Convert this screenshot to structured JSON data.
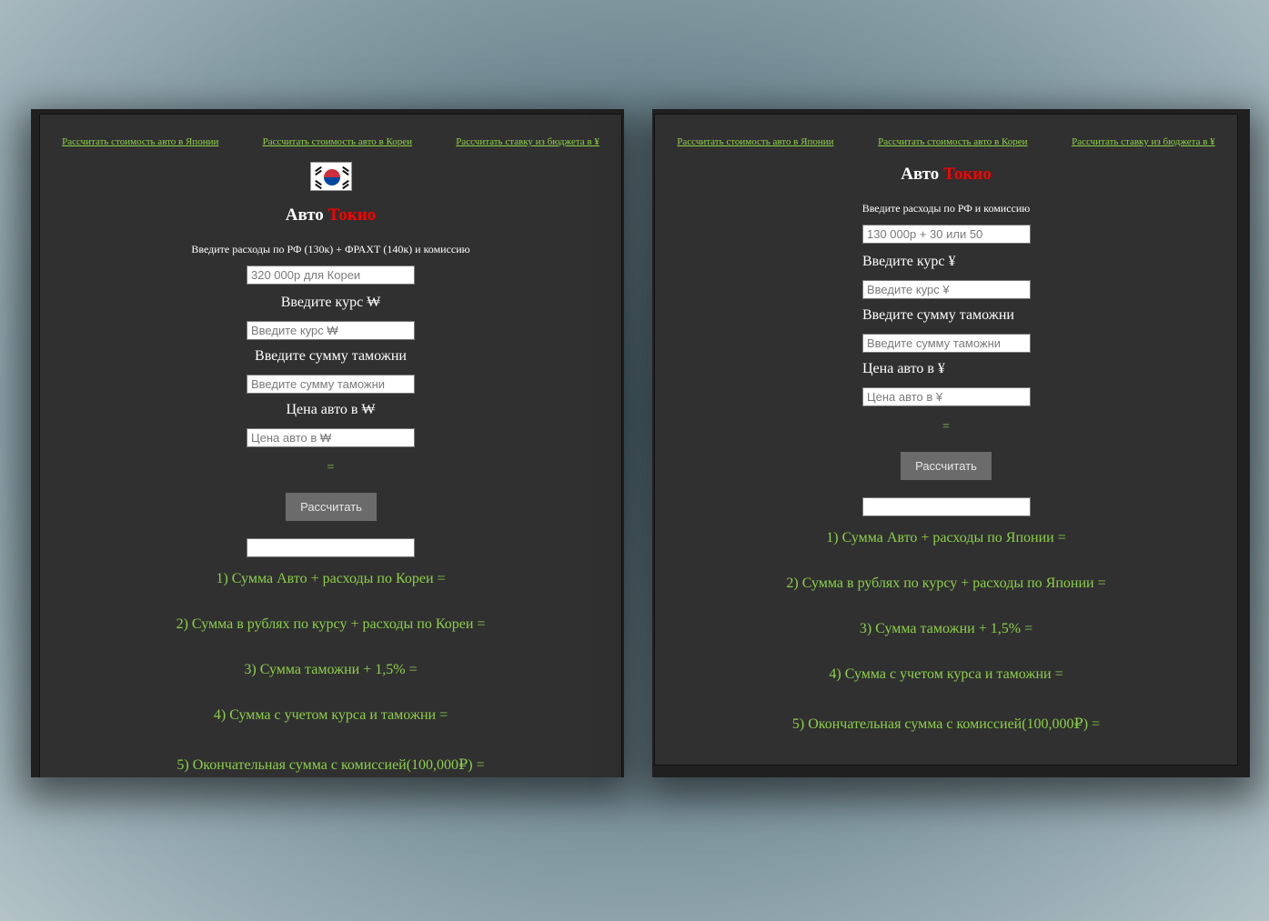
{
  "korea": {
    "nav": [
      "Рассчитать стоимость авто в Японии",
      "Рассчитать стоимость авто в Кореи",
      "Рассчитать ставку из бюджета в ¥"
    ],
    "title_prefix": "Авто",
    "title_brand": "Токио",
    "expenses_hint": "Введите расходы по РФ (130к) + ФРАХТ (140к) и комиссию",
    "expenses_placeholder": "320 000р для Кореи",
    "rate_label": "Введите курс ₩",
    "rate_placeholder": "Введите курс ₩",
    "customs_label": "Введите сумму таможни",
    "customs_placeholder": "Введите сумму таможни",
    "price_label": "Цена авто в ₩",
    "price_placeholder": "Цена авто в ₩",
    "equals": "=",
    "calc_button": "Рассчитать",
    "results": [
      "1) Сумма Авто + расходы по Кореи =",
      "2) Сумма в рублях по курсу + расходы по Кореи =",
      "3) Сумма таможни + 1,5% =",
      "4) Сумма с учетом курса и таможни =",
      "5) Окончательная сумма с комиссией(100,000₽) ="
    ]
  },
  "japan": {
    "nav": [
      "Рассчитать стоимость авто в Японии",
      "Рассчитать стоимость авто в Кореи",
      "Рассчитать ставку из бюджета в ¥"
    ],
    "title_prefix": "Авто",
    "title_brand": "Токио",
    "expenses_hint": "Введите расходы по РФ и комиссию",
    "expenses_placeholder": "130 000р + 30 или 50",
    "rate_label": "Введите курс ¥",
    "rate_placeholder": "Введите курс ¥",
    "customs_label": "Введите сумму таможни",
    "customs_placeholder": "Введите сумму таможни",
    "price_label": "Цена авто в ¥",
    "price_placeholder": "Цена авто в ¥",
    "equals": "=",
    "calc_button": "Рассчитать",
    "results": [
      "1) Сумма Авто + расходы по Японии =",
      "2) Сумма в рублях по курсу + расходы по Японии =",
      "3) Сумма таможни + 1,5% =",
      "4) Сумма с учетом курса и таможни =",
      "5) Окончательная сумма с комиссией(100,000₽) ="
    ]
  },
  "colors": {
    "panel_bg": "#303030",
    "link": "#8fd14a",
    "result_text": "#8ccf4a",
    "brand_red": "#ff0000",
    "button_bg": "#6b6b6b"
  },
  "icons": {
    "flag": "south-korea-flag-icon"
  }
}
